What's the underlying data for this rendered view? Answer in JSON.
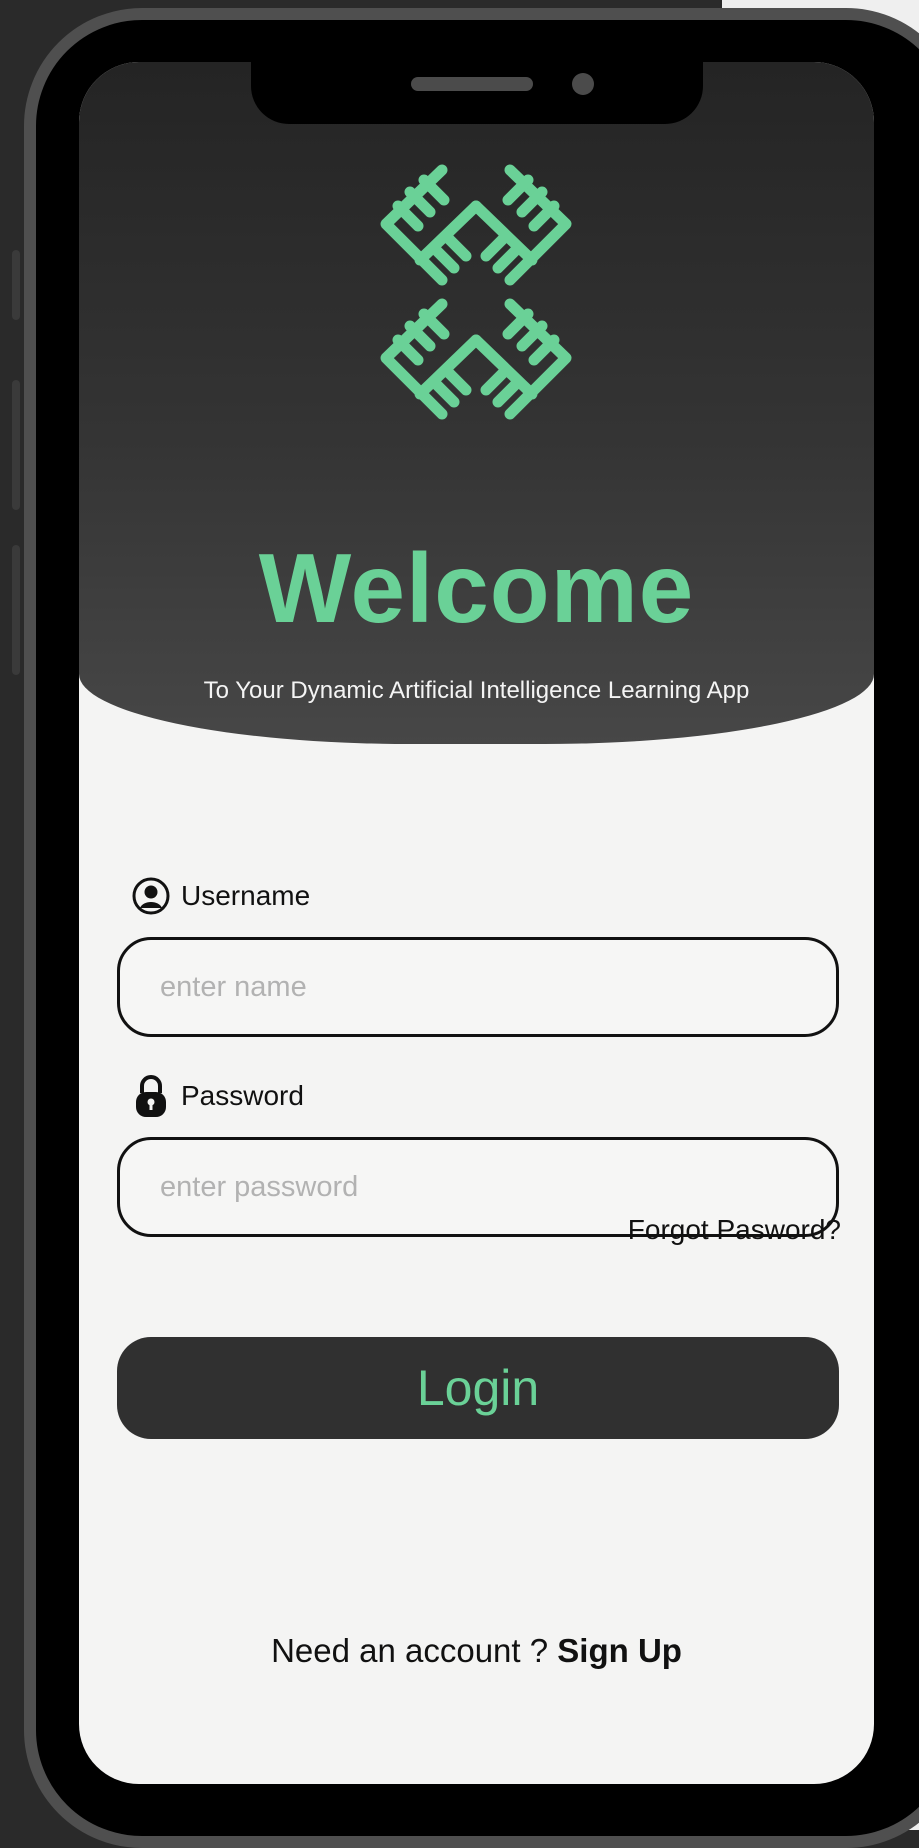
{
  "header": {
    "title": "Welcome",
    "subtitle": "To Your Dynamic Artificial Intelligence Learning App",
    "logo_icon": "green-chevron-lattice-logo"
  },
  "form": {
    "username": {
      "label": "Username",
      "placeholder": "enter name",
      "icon": "user-circle-icon"
    },
    "password": {
      "label": "Password",
      "placeholder": "enter password",
      "icon": "lock-icon"
    },
    "forgot_label": "Forgot Pasword?",
    "login_label": "Login"
  },
  "footer": {
    "prompt": "Need an account ?",
    "signup_label": "Sign Up"
  },
  "colors": {
    "accent": "#6ad197",
    "header_dark": "#242424",
    "button_bg": "#303030",
    "screen_bg": "#f4f4f3"
  }
}
